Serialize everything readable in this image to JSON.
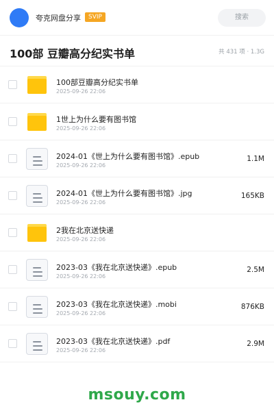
{
  "header": {
    "brand": "夸克网盘分享",
    "badge": "SVIP",
    "search_placeholder": "搜索"
  },
  "folder": {
    "title": "100部 豆瓣高分纪实书单",
    "meta": "共 431 项 · 1.3G"
  },
  "files": [
    {
      "name": "100部豆瓣高分纪实书单",
      "date": "2025-09-26 22:06",
      "size": "",
      "type": "folder-icon"
    },
    {
      "name": "1世上为什么要有图书馆",
      "date": "2025-09-26 22:06",
      "size": "",
      "type": "folder-icon"
    },
    {
      "name": "2024-01《世上为什么要有图书馆》.epub",
      "date": "2025-09-26 22:06",
      "size": "1.1M",
      "type": "file-icon"
    },
    {
      "name": "2024-01《世上为什么要有图书馆》.jpg",
      "date": "2025-09-26 22:06",
      "size": "165KB",
      "type": "file-icon"
    },
    {
      "name": "2我在北京送快递",
      "date": "2025-09-26 22:06",
      "size": "",
      "type": "folder-icon"
    },
    {
      "name": "2023-03《我在北京送快递》.epub",
      "date": "2025-09-26 22:06",
      "size": "2.5M",
      "type": "file-icon"
    },
    {
      "name": "2023-03《我在北京送快递》.mobi",
      "date": "2025-09-26 22:06",
      "size": "876KB",
      "type": "file-icon"
    },
    {
      "name": "2023-03《我在北京送快递》.pdf",
      "date": "2025-09-26 22:06",
      "size": "2.9M",
      "type": "file-icon"
    }
  ],
  "watermark": "msouy.com",
  "colors": {
    "accent": "#2f7bf6",
    "svip": "#f5a623",
    "folder": "#ffc40c",
    "watermark": "#2fa84a"
  }
}
